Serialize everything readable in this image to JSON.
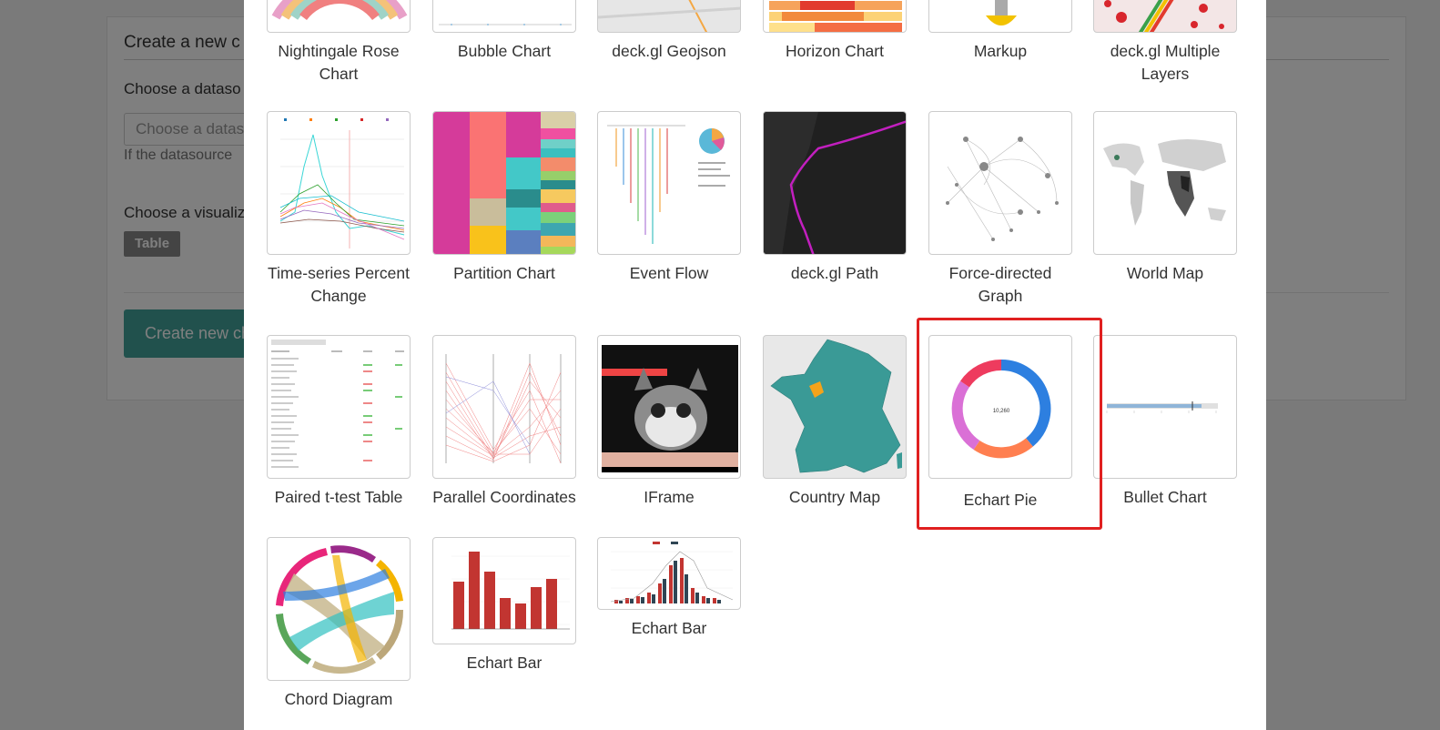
{
  "background": {
    "title": "Create a new c",
    "datasource_label": "Choose a dataso",
    "datasource_placeholder": "Choose a datas",
    "datasource_help": "If the datasource",
    "visualization_label": "Choose a visualiz",
    "selected_viz": "Table",
    "create_button": "Create new ch"
  },
  "viz_types": [
    {
      "id": "nightingale",
      "label": "Nightingale Rose Chart"
    },
    {
      "id": "bubble",
      "label": "Bubble Chart"
    },
    {
      "id": "geojson",
      "label": "deck.gl Geojson"
    },
    {
      "id": "horizon",
      "label": "Horizon Chart"
    },
    {
      "id": "markup",
      "label": "Markup"
    },
    {
      "id": "multilayer",
      "label": "deck.gl Multiple Layers"
    },
    {
      "id": "timeseries",
      "label": "Time-series Percent Change"
    },
    {
      "id": "partition",
      "label": "Partition Chart"
    },
    {
      "id": "eventflow",
      "label": "Event Flow"
    },
    {
      "id": "path",
      "label": "deck.gl Path"
    },
    {
      "id": "force",
      "label": "Force-directed Graph"
    },
    {
      "id": "worldmap",
      "label": "World Map"
    },
    {
      "id": "ttest",
      "label": "Paired t-test Table"
    },
    {
      "id": "parallel",
      "label": "Parallel Coordinates"
    },
    {
      "id": "iframe",
      "label": "IFrame"
    },
    {
      "id": "country",
      "label": "Country Map"
    },
    {
      "id": "echartpie",
      "label": "Echart Pie",
      "selected": true
    },
    {
      "id": "bullet",
      "label": "Bullet Chart"
    },
    {
      "id": "chord",
      "label": "Chord Diagram"
    },
    {
      "id": "echartbar1",
      "label": "Echart Bar"
    },
    {
      "id": "echartbar2",
      "label": "Echart Bar"
    }
  ],
  "pie_thumb": {
    "center_value": "10,260",
    "colors": [
      "#2d7fe0",
      "#ff7f50",
      "#da70d6",
      "#ee3b5e"
    ]
  },
  "highlight_color": "#e02020"
}
